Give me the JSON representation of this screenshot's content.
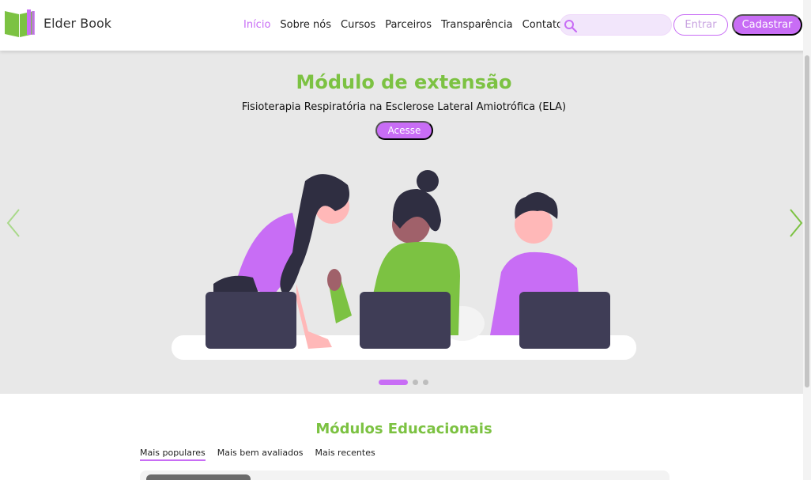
{
  "brand": {
    "name": "Elder Book",
    "accent": "#c86df5",
    "green": "#7cc242"
  },
  "nav": {
    "items": [
      {
        "label": "Início",
        "active": true
      },
      {
        "label": "Sobre nós",
        "active": false
      },
      {
        "label": "Cursos",
        "active": false
      },
      {
        "label": "Parceiros",
        "active": false
      },
      {
        "label": "Transparência",
        "active": false
      },
      {
        "label": "Contato",
        "active": false
      }
    ]
  },
  "search": {
    "placeholder": "",
    "value": "",
    "icon": "search-icon"
  },
  "auth": {
    "login_label": "Entrar",
    "signup_label": "Cadastrar"
  },
  "hero": {
    "title": "Módulo de extensão",
    "subtitle": "Fisioterapia Respiratória na Esclerose Lateral Amiotrófica (ELA)",
    "cta_label": "Acesse",
    "slide_count": 3,
    "active_slide": 1
  },
  "modules": {
    "title": "Módulos Educacionais",
    "tabs": [
      {
        "label": "Mais populares",
        "active": true
      },
      {
        "label": "Mais bem avaliados",
        "active": false
      },
      {
        "label": "Mais recentes",
        "active": false
      }
    ]
  }
}
